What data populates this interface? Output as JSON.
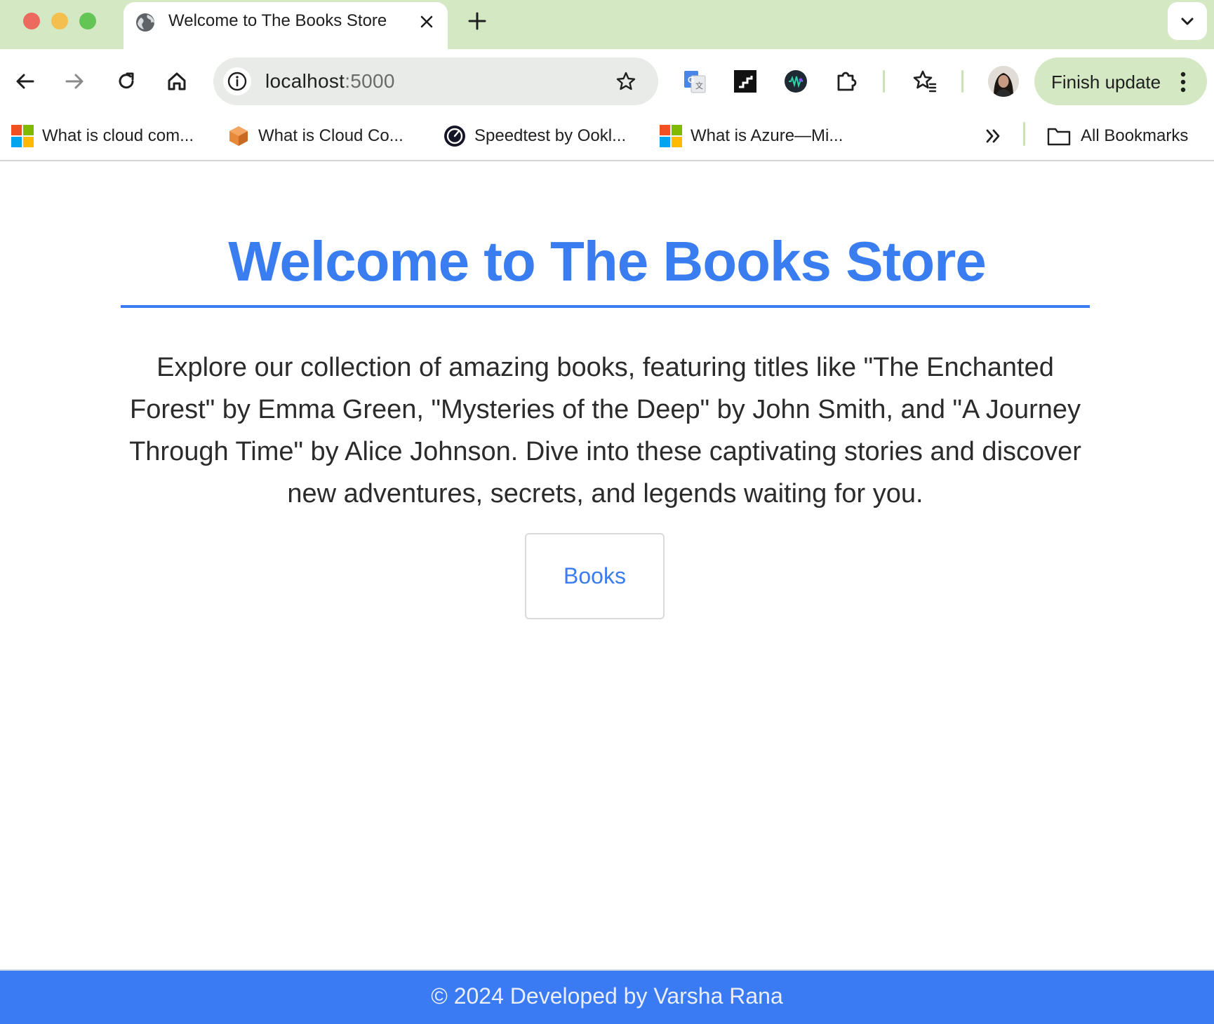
{
  "browser": {
    "tab": {
      "title": "Welcome to The Books Store"
    },
    "address_bar": {
      "host": "localhost",
      "port": ":5000"
    },
    "finish_update_label": "Finish update",
    "bookmarks": [
      {
        "label": "What is cloud com...",
        "icon": "microsoft-logo-icon"
      },
      {
        "label": "What is Cloud Co...",
        "icon": "cube-icon"
      },
      {
        "label": "Speedtest by Ookl...",
        "icon": "speedtest-icon"
      },
      {
        "label": "What is Azure—Mi...",
        "icon": "microsoft-logo-icon"
      }
    ],
    "all_bookmarks_label": "All Bookmarks"
  },
  "page": {
    "title": "Welcome to The Books Store",
    "description": "Explore our collection of amazing books, featuring titles like \"The Enchanted Forest\" by Emma Green, \"Mysteries of the Deep\" by John Smith, and \"A Journey Through Time\" by Alice Johnson. Dive into these captivating stories and discover new adventures, secrets, and legends waiting for you.",
    "books_button_label": "Books",
    "footer_text": "© 2024 Developed by Varsha Rana"
  },
  "colors": {
    "accent": "#3a7df0",
    "tabstrip": "#d3e8c3",
    "footer": "#3a7af2"
  }
}
